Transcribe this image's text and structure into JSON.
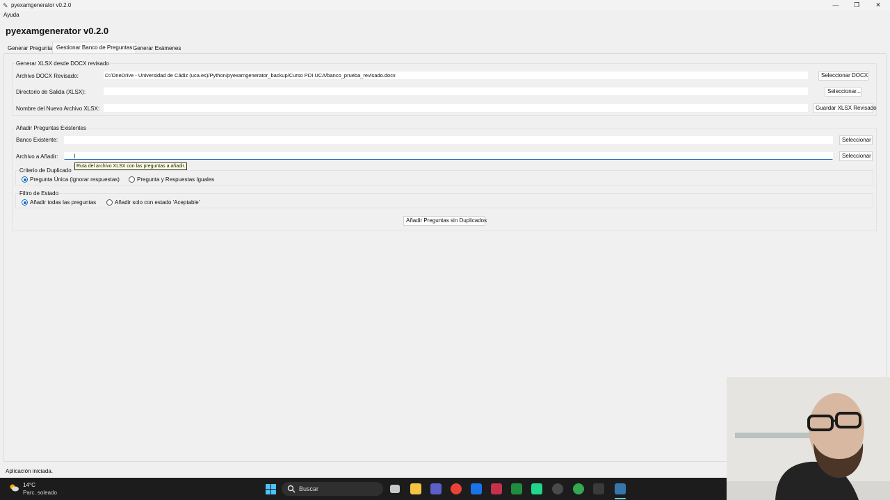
{
  "window": {
    "title": "pyexamgenerator v0.2.0",
    "minimize_glyph": "—",
    "maximize_glyph": "❐",
    "close_glyph": "✕"
  },
  "menu": {
    "help": "Ayuda"
  },
  "app": {
    "heading": "pyexamgenerator v0.2.0"
  },
  "tabs": [
    {
      "label": "Generar Preguntas",
      "active": false
    },
    {
      "label": "Gestionar Banco de Preguntas",
      "active": true
    },
    {
      "label": "Generar Exámenes",
      "active": false
    }
  ],
  "generate_xlsx": {
    "title": "Generar XLSX desde DOCX revisado",
    "docx_label": "Archivo DOCX Revisado:",
    "docx_value": "D:/OneDrive - Universidad de Cádiz (uca.es)/Python/pyexamgenerator_backup/Curso PDI UCA/banco_prueba_revisado.docx",
    "docx_button": "Seleccionar DOCX",
    "outdir_label": "Directorio de Salida (XLSX):",
    "outdir_value": "",
    "outdir_button": "Seleccionar...",
    "name_label": "Nombre del Nuevo Archivo XLSX:",
    "name_value": "",
    "save_button": "Guardar XLSX Revisado"
  },
  "add_existing": {
    "title": "Añadir Preguntas Existentes",
    "bank_label": "Banco Existente:",
    "bank_value": "",
    "bank_button": "Seleccionar",
    "file_label": "Archivo a Añadir:",
    "file_value": "",
    "file_button": "Seleccionar",
    "tooltip": "Ruta del archivo XLSX con las preguntas a añadir.",
    "duplicate_title": "Criterio de Duplicado",
    "duplicate_options": [
      {
        "label": "Pregunta Única (ignorar respuestas)",
        "selected": true
      },
      {
        "label": "Pregunta y Respuestas Iguales",
        "selected": false
      }
    ],
    "filter_title": "Filtro de Estado",
    "filter_options": [
      {
        "label": "Añadir todas las preguntas",
        "selected": true
      },
      {
        "label": "Añadir solo con estado 'Aceptable'",
        "selected": false
      }
    ],
    "add_button": "Añadir Preguntas sin Duplicados"
  },
  "status": {
    "text": "Aplicación iniciada."
  },
  "taskbar": {
    "weather_temp": "14°C",
    "weather_desc": "Parc. soleado",
    "search_placeholder": "Buscar",
    "accent": "#60cdff"
  }
}
